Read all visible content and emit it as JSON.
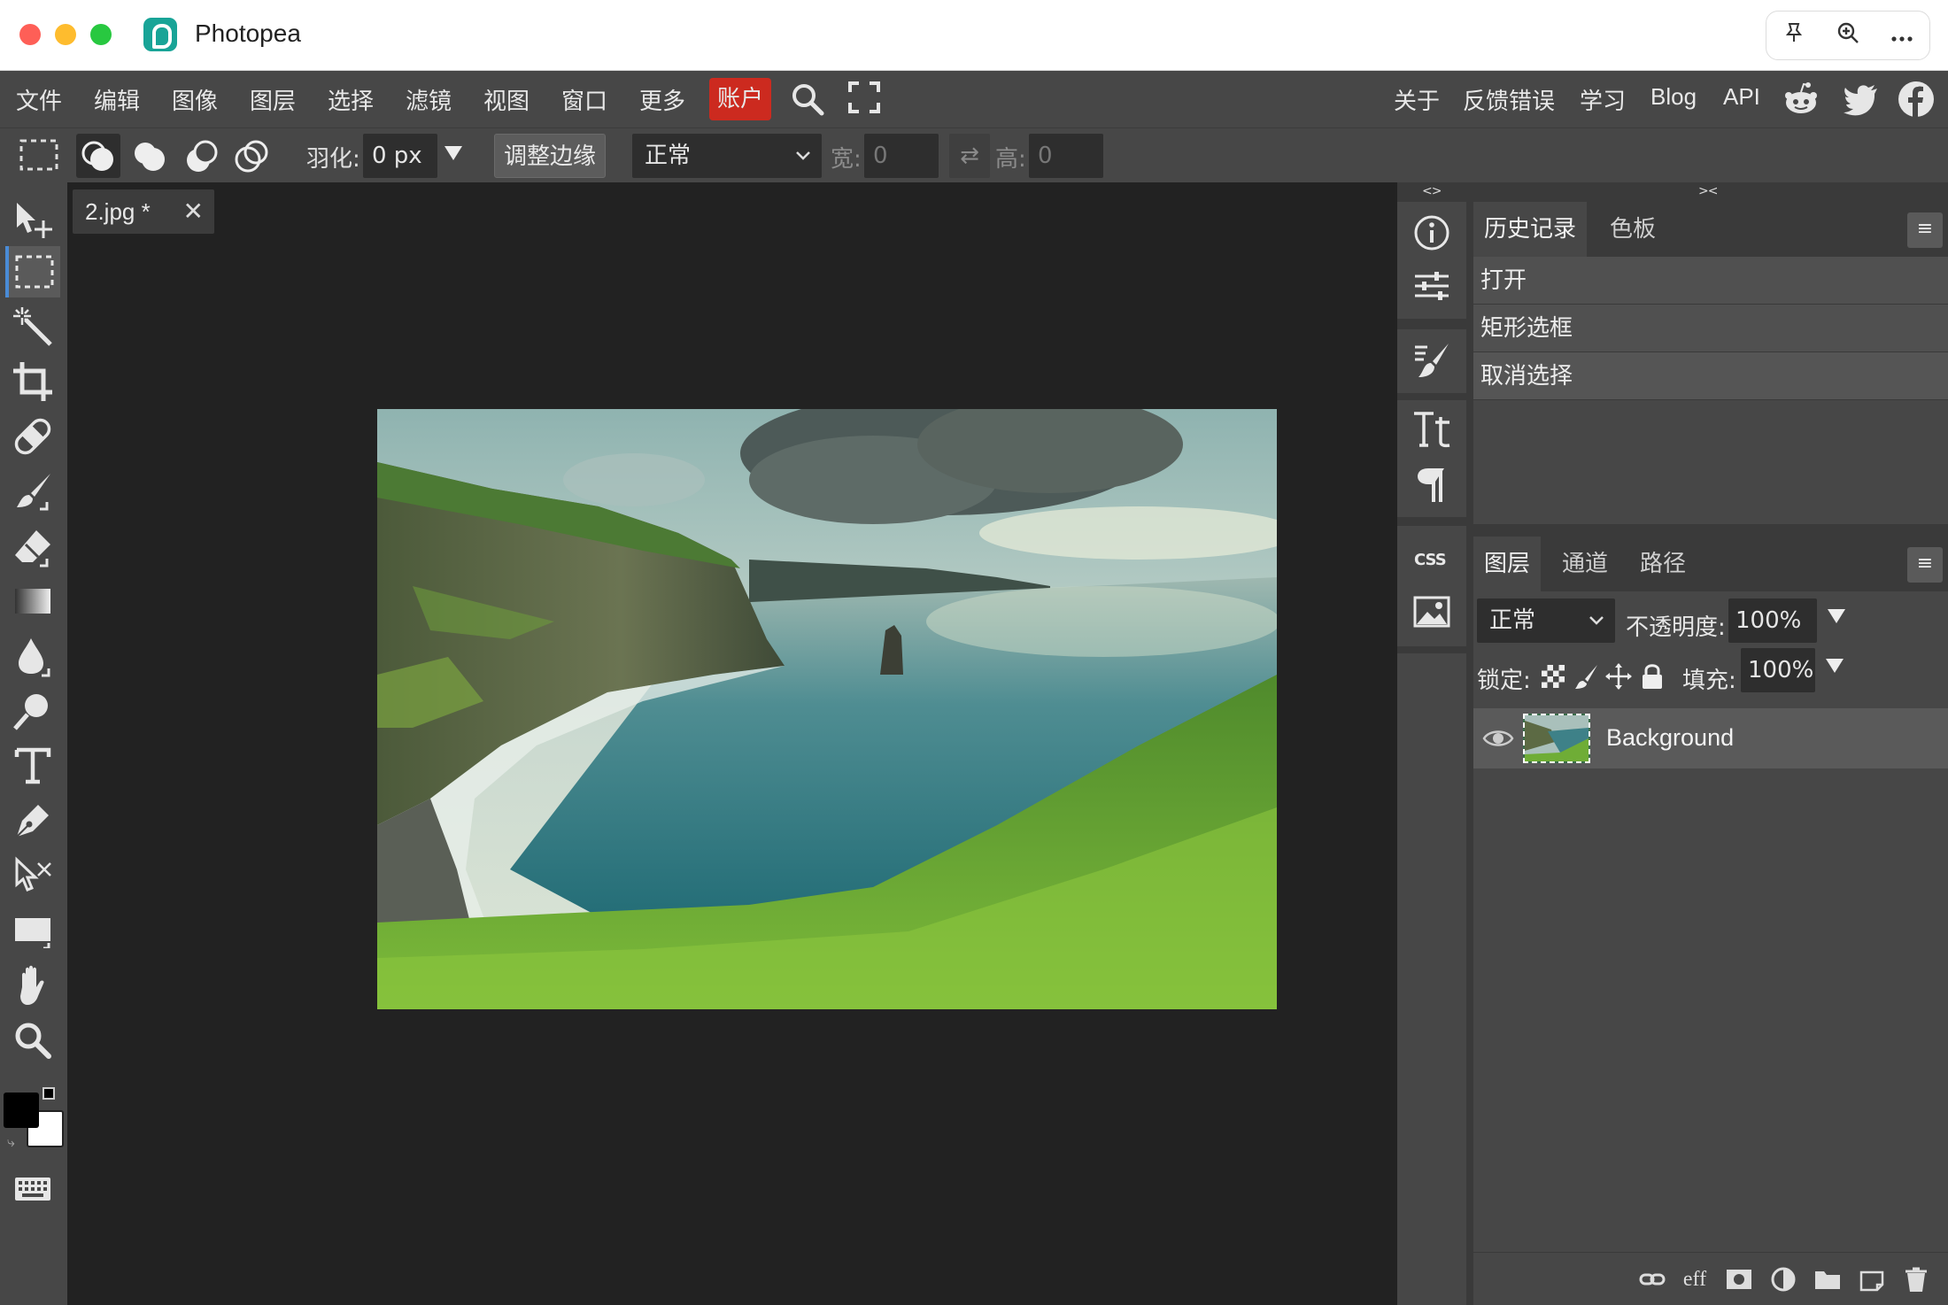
{
  "window": {
    "title": "Photopea",
    "actions": [
      "pin-icon",
      "zoom-in-icon",
      "more-icon"
    ]
  },
  "menu": {
    "items": [
      "文件",
      "编辑",
      "图像",
      "图层",
      "选择",
      "滤镜",
      "视图",
      "窗口",
      "更多"
    ],
    "account": "账户",
    "right_items": [
      "关于",
      "反馈错误",
      "学习",
      "Blog",
      "API"
    ],
    "social": [
      "reddit-icon",
      "twitter-icon",
      "facebook-icon"
    ]
  },
  "options": {
    "feather_label": "羽化:",
    "feather_value": "0 px",
    "refine_edge": "调整边缘",
    "style_value": "正常",
    "width_label": "宽:",
    "width_value": "0",
    "height_label": "高:",
    "height_value": "0"
  },
  "document": {
    "tab_name": "2.jpg *",
    "tab_close": "✕"
  },
  "tools": [
    "move-tool-icon",
    "rect-select-tool-icon",
    "magic-wand-tool-icon",
    "crop-tool-icon",
    "healing-tool-icon",
    "brush-tool-icon",
    "eraser-tool-icon",
    "gradient-tool-icon",
    "blur-tool-icon",
    "dodge-tool-icon",
    "type-tool-icon",
    "pen-tool-icon",
    "path-select-tool-icon",
    "shape-tool-icon",
    "hand-tool-icon",
    "zoom-tool-icon"
  ],
  "history_panel": {
    "tabs": [
      "历史记录",
      "色板"
    ],
    "entries": [
      "打开",
      "矩形选框",
      "取消选择"
    ]
  },
  "layers_panel": {
    "tabs": [
      "图层",
      "通道",
      "路径"
    ],
    "blend_mode": "正常",
    "opacity_label": "不透明度:",
    "opacity_value": "100%",
    "lock_label": "锁定:",
    "fill_label": "填充:",
    "fill_value": "100%",
    "layers": [
      {
        "name": "Background",
        "visible": true
      }
    ],
    "footer_icons": [
      "link-icon",
      "effects-icon",
      "mask-icon",
      "adjustment-icon",
      "folder-icon",
      "new-layer-icon",
      "trash-icon"
    ],
    "footer_effects_text": "eff"
  },
  "colors": {
    "accent": "#4a8bd6",
    "account_button": "#cc2a1f",
    "foreground": "#000000",
    "background": "#ffffff"
  }
}
